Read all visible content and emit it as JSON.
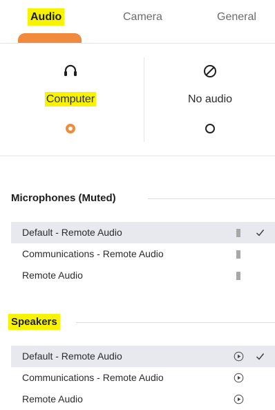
{
  "tabs": {
    "audio": "Audio",
    "camera": "Camera",
    "general": "General"
  },
  "options": {
    "computer_label": "Computer",
    "no_audio_label": "No audio",
    "computer_icon": "headset-icon",
    "no_audio_icon": "no-audio-icon"
  },
  "microphones": {
    "heading": "Microphones (Muted)",
    "items": [
      {
        "label": "Default - Remote Audio"
      },
      {
        "label": "Communications - Remote Audio"
      },
      {
        "label": "Remote Audio"
      }
    ]
  },
  "speakers": {
    "heading": "Speakers",
    "items": [
      {
        "label": "Default - Remote Audio"
      },
      {
        "label": "Communications - Remote Audio"
      },
      {
        "label": "Remote Audio"
      }
    ]
  },
  "colors": {
    "accent": "#f08a3c",
    "highlight": "#f8f400",
    "selected_row": "#e7e9ef"
  }
}
